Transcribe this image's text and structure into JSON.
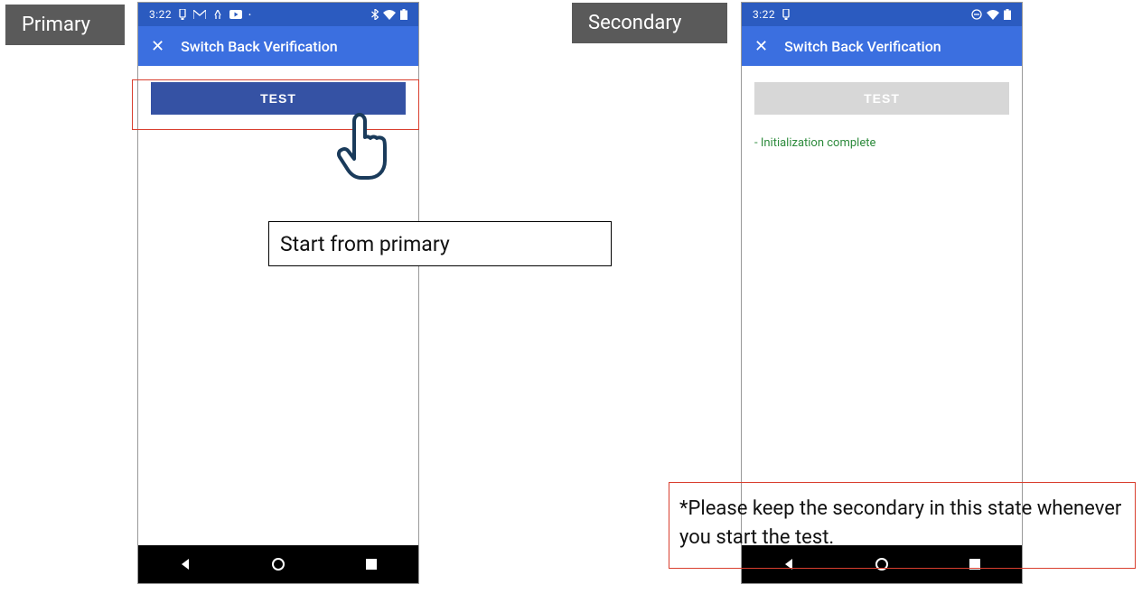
{
  "labels": {
    "primary": "Primary",
    "secondary": "Secondary"
  },
  "status_bar": {
    "time": "3:22"
  },
  "app_bar": {
    "title": "Switch Back Verification",
    "close_symbol": "✕"
  },
  "buttons": {
    "test": "TEST"
  },
  "right_status_msg": "- Initialization complete",
  "caption": "Start from primary",
  "note": "*Please keep the secondary in this state whenever you start the test."
}
